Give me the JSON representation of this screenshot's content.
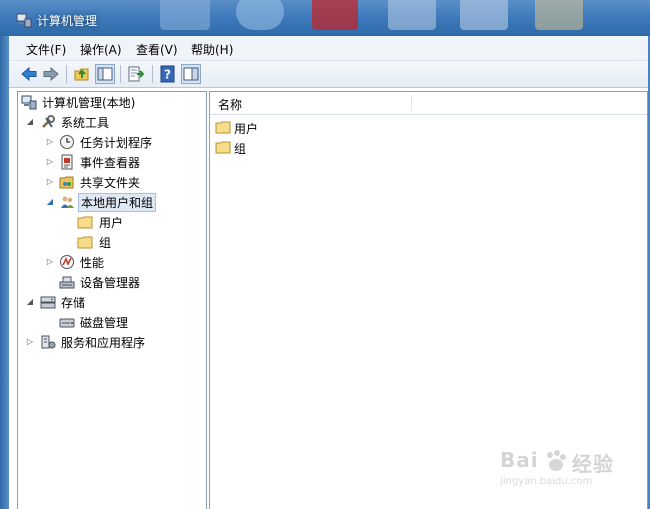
{
  "window": {
    "title": "计算机管理"
  },
  "menu": [
    "文件(F)",
    "操作(A)",
    "查看(V)",
    "帮助(H)"
  ],
  "toolbar": {
    "buttons": [
      "back-icon",
      "forward-icon",
      "up-folder-icon",
      "show-hide-tree-icon",
      "export-list-icon",
      "help-icon",
      "show-hide-action-pane-icon"
    ]
  },
  "tree": {
    "root": "计算机管理(本地)",
    "system_tools": "系统工具",
    "task_scheduler": "任务计划程序",
    "event_viewer": "事件查看器",
    "shared_folders": "共享文件夹",
    "local_users_groups": "本地用户和组",
    "users": "用户",
    "groups": "组",
    "performance": "性能",
    "device_manager": "设备管理器",
    "storage": "存储",
    "disk_management": "磁盘管理",
    "services_apps": "服务和应用程序"
  },
  "list": {
    "column_name": "名称",
    "items": [
      "用户",
      "组"
    ]
  },
  "watermark": {
    "brand": "Bai",
    "brand2": "经验",
    "url": "jingyan.baidu.com"
  },
  "colors": {
    "titlebar": "#3f7bbd",
    "selection": "#dfe9f5",
    "folder": "#f2d26b"
  }
}
